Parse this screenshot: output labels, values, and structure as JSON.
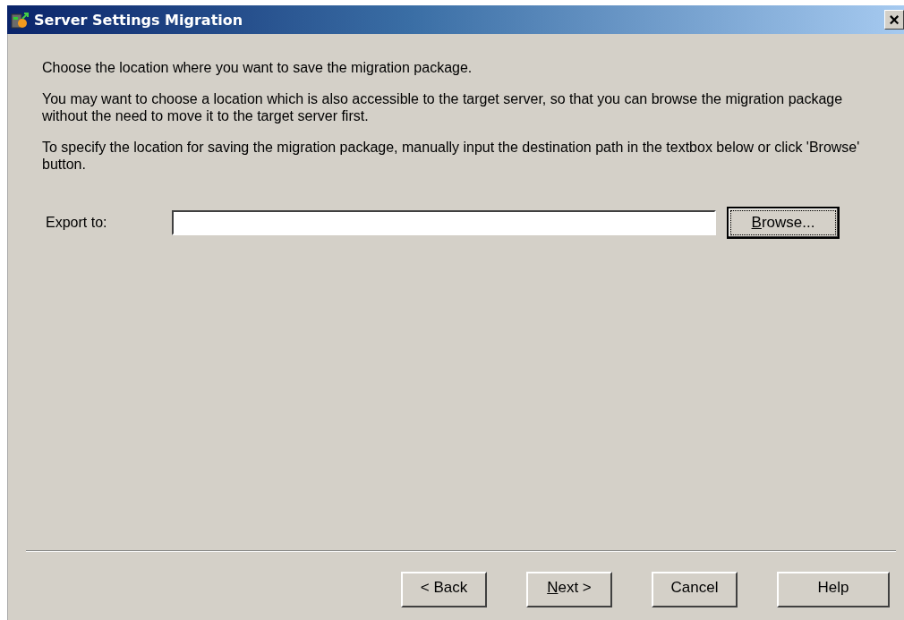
{
  "window": {
    "title": "Server Settings Migration",
    "close": "×"
  },
  "paragraphs": [
    "Choose the location where you want to save the migration package.",
    "You may want to choose a location which is also accessible to the target server, so that you can browse the migration package without the need to move it to the target server first.",
    "To specify the location for saving the migration package, manually input the destination path in the textbox below or click 'Browse' button."
  ],
  "export": {
    "label": "Export to:",
    "browse": {
      "label": "Browse...",
      "mnemonic_underlined": true,
      "focused": true
    }
  },
  "buttons": [
    {
      "label": "< Back",
      "focused": false
    },
    {
      "label": "Next >",
      "mnemonic_underlined": true,
      "focused": false
    },
    {
      "label": "Cancel",
      "focused": false
    },
    {
      "label": "Help",
      "focused": false
    }
  ]
}
